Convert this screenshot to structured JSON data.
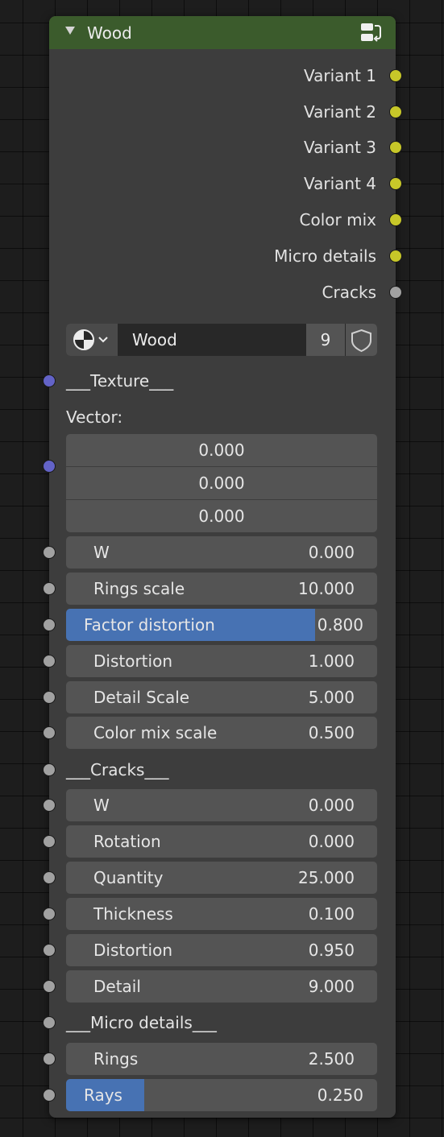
{
  "node": {
    "title": "Wood",
    "header_color": "#3b5b2c",
    "outputs": [
      {
        "label": "Variant 1",
        "socket": "yellow"
      },
      {
        "label": "Variant 2",
        "socket": "yellow"
      },
      {
        "label": "Variant 3",
        "socket": "yellow"
      },
      {
        "label": "Variant 4",
        "socket": "yellow"
      },
      {
        "label": "Color mix",
        "socket": "yellow"
      },
      {
        "label": "Micro details",
        "socket": "yellow"
      },
      {
        "label": "Cracks",
        "socket": "gray"
      }
    ],
    "node_group": {
      "type_icon": "node-tree-icon",
      "name": "Wood",
      "users": "9",
      "fake_user_icon": "shield-icon"
    },
    "texture_section": "___Texture___",
    "vector": {
      "label": "Vector:",
      "values": [
        "0.000",
        "0.000",
        "0.000"
      ]
    },
    "texture_fields": [
      {
        "label": "W",
        "value": "0.000"
      },
      {
        "label": "Rings scale",
        "value": "10.000"
      },
      {
        "label": "Factor distortion",
        "value": "0.800",
        "factor": 0.8
      },
      {
        "label": "Distortion",
        "value": "1.000"
      },
      {
        "label": "Detail Scale",
        "value": "5.000"
      },
      {
        "label": "Color mix scale",
        "value": "0.500"
      }
    ],
    "cracks_section": "___Cracks___",
    "cracks_fields": [
      {
        "label": "W",
        "value": "0.000"
      },
      {
        "label": "Rotation",
        "value": "0.000"
      },
      {
        "label": "Quantity",
        "value": "25.000"
      },
      {
        "label": "Thickness",
        "value": "0.100"
      },
      {
        "label": "Distortion",
        "value": "0.950"
      },
      {
        "label": "Detail",
        "value": "9.000"
      }
    ],
    "micro_section": "___Micro details___",
    "micro_fields": [
      {
        "label": "Rings",
        "value": "2.500"
      },
      {
        "label": "Rays",
        "value": "0.250",
        "factor": 0.25
      }
    ]
  },
  "colors": {
    "socket_float": "#a1a1a1",
    "socket_color": "#c7c729",
    "socket_vector": "#6363c7",
    "slider_fill": "#4772b3"
  }
}
